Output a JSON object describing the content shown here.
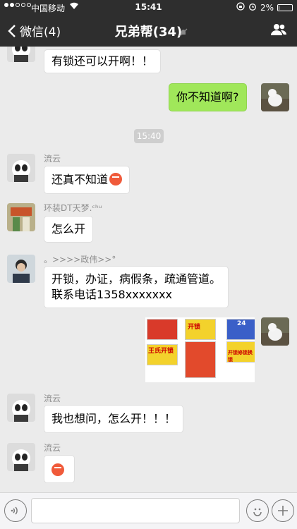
{
  "status": {
    "carrier": "中国移动",
    "time": "15:41",
    "battery": "2%",
    "battery_level": 0.02
  },
  "nav": {
    "back_label": "微信(4)",
    "title": "兄弟帮(34)"
  },
  "messages": [
    {
      "side": "left",
      "sender": "",
      "text": "有锁还可以开啊！！"
    },
    {
      "side": "right",
      "text": "你不知道啊?"
    },
    {
      "type": "time",
      "text": "15:40"
    },
    {
      "side": "left",
      "sender": "流云",
      "text": "还真不知道"
    },
    {
      "side": "left",
      "sender": "环装DT天梦.ᶜʰᵘ",
      "text": "怎么开"
    },
    {
      "side": "left",
      "sender": "。>>>>政伟>>°",
      "line1": "开锁，办证，病假条，疏通管道。",
      "line2": "联系电话1358xxxxxxx"
    },
    {
      "side": "right",
      "type": "image",
      "ad_text": [
        "开锁",
        "王氏开锁",
        "24",
        "开锁修锁换锁"
      ]
    },
    {
      "side": "left",
      "sender": "流云",
      "text": "我也想问，怎么开！！！"
    },
    {
      "side": "left",
      "sender": "流云",
      "text": ""
    }
  ],
  "colors": {
    "nav_bg": "#2e2e2e",
    "chat_bg": "#ebebeb",
    "my_bubble": "#a0e75a",
    "other_bubble": "#ffffff"
  },
  "icons": {
    "back": "chevron-left-icon",
    "mute": "bell-off-icon",
    "group": "people-icon",
    "voice": "voice-icon",
    "emoji": "smile-icon",
    "plus": "plus-icon"
  }
}
